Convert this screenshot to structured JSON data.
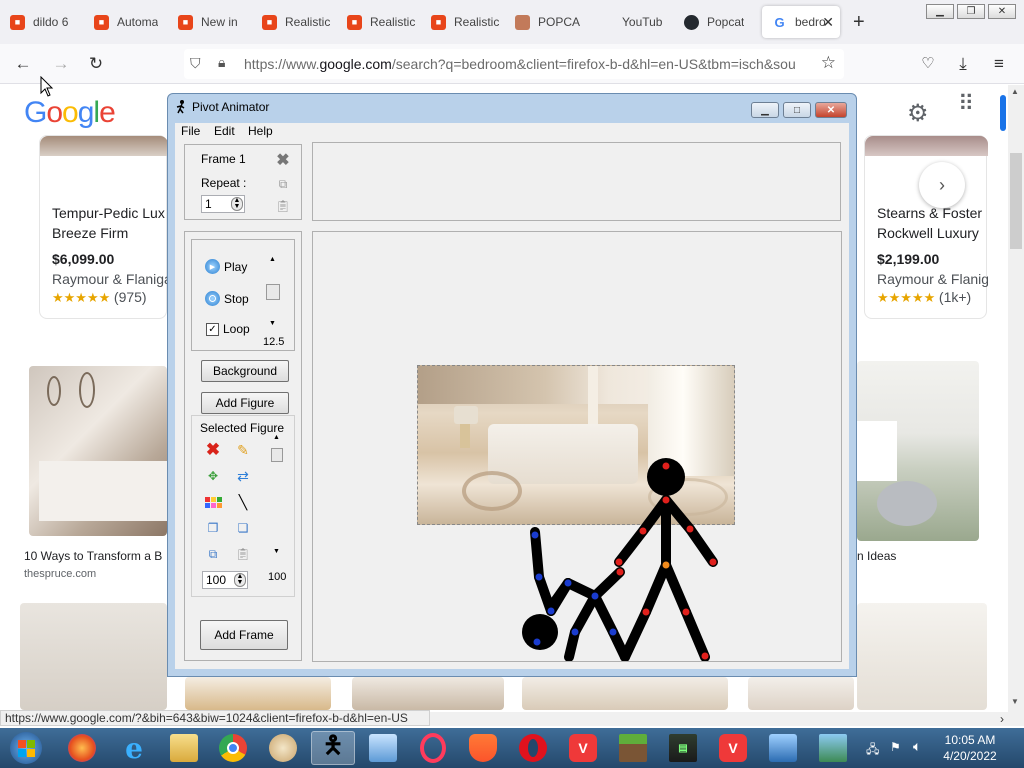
{
  "browser": {
    "tabs": [
      {
        "label": "dildo 6",
        "icon": "red-shop-icon",
        "color": "#e8451a"
      },
      {
        "label": "Automa",
        "icon": "red-shop-icon",
        "color": "#e8451a"
      },
      {
        "label": "New in",
        "icon": "red-shop-icon",
        "color": "#e8451a"
      },
      {
        "label": "Realistic",
        "icon": "red-shop-icon",
        "color": "#e8451a"
      },
      {
        "label": "Realistic",
        "icon": "red-shop-icon",
        "color": "#e8451a"
      },
      {
        "label": "Realistic",
        "icon": "red-shop-icon",
        "color": "#e8451a"
      },
      {
        "label": "POPCA",
        "icon": "popcat-icon",
        "color": "#c27a5a"
      },
      {
        "label": "YouTub",
        "icon": "youtube-icon",
        "color": "#ffffff"
      },
      {
        "label": "Popcat",
        "icon": "github-icon",
        "color": "#24292f"
      },
      {
        "label": "bedro",
        "icon": "google-icon",
        "color": "#ffffff"
      }
    ],
    "url_prefix": "https://www.",
    "url_domain": "google.com",
    "url_rest": "/search?q=bedroom&client=firefox-b-d&hl=en-US&tbm=isch&sou",
    "status_url": "https://www.google.com/?&bih=643&biw=1024&client=firefox-b-d&hl=en-US"
  },
  "google": {
    "logo": "Google",
    "products": [
      {
        "title1": "Tempur-Pedic Lux",
        "title2": "Breeze Firm",
        "price": "$6,099.00",
        "store": "Raymour & Flaniga",
        "stars": "★★★★★",
        "count": "(975)"
      },
      {
        "title1": "Stearns & Foster",
        "title2": "Rockwell Luxury",
        "price": "$2,199.00",
        "store": "Raymour & Flanig",
        "stars": "★★★★★",
        "count": "(1k+)"
      }
    ],
    "image_result_left": {
      "caption": "10 Ways to Transform a B",
      "source": "thespruce.com"
    },
    "image_result_right": {
      "caption": "n Ideas"
    }
  },
  "pivot": {
    "title": "Pivot Animator",
    "menus": [
      "File",
      "Edit",
      "Help"
    ],
    "frame_label": "Frame 1",
    "repeat_label": "Repeat :",
    "repeat_value": "1",
    "play_label": "Play",
    "stop_label": "Stop",
    "loop_label": "Loop",
    "speed_value": "12.5",
    "background_button": "Background",
    "add_figure_button": "Add Figure",
    "selected_figure_label": "Selected Figure",
    "scale_value": "100",
    "scale_readout": "100",
    "add_frame_button": "Add Frame"
  },
  "taskbar": {
    "time": "10:05 AM",
    "date": "4/20/2022"
  },
  "colors": {
    "firefox_tab_bg": "#f0f0f4",
    "pivot_frame": "#b9d1ea",
    "taskbar": "#24486b",
    "joint_red": "#e0201c",
    "joint_blue": "#1a3ccf",
    "joint_orange": "#f08a1c"
  }
}
